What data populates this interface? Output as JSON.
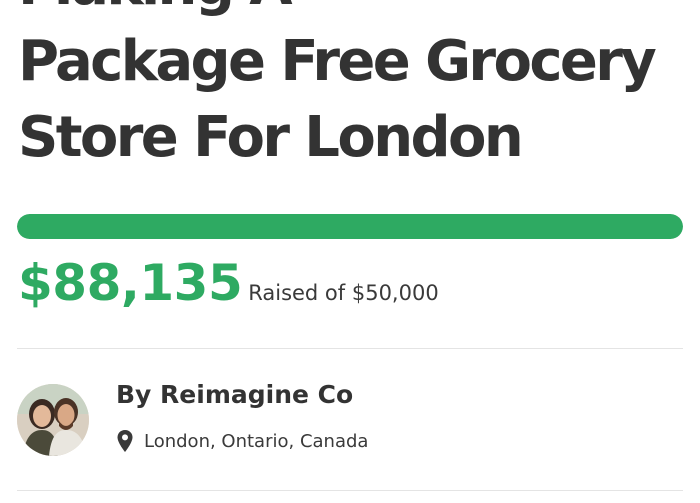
{
  "campaign": {
    "title_lines": [
      "Package Free Grocery",
      "Store For London"
    ]
  },
  "progress": {
    "fraction_raised": 1.0,
    "bar_color": "#2eaa62"
  },
  "funding": {
    "amount_raised": "$88,135",
    "goal_text": "Raised of $50,000"
  },
  "organizer": {
    "name": "By Reimagine Co",
    "location": "London, Ontario, Canada",
    "location_icon": "map-pin-icon",
    "avatar": "organizer-avatar-photo"
  }
}
